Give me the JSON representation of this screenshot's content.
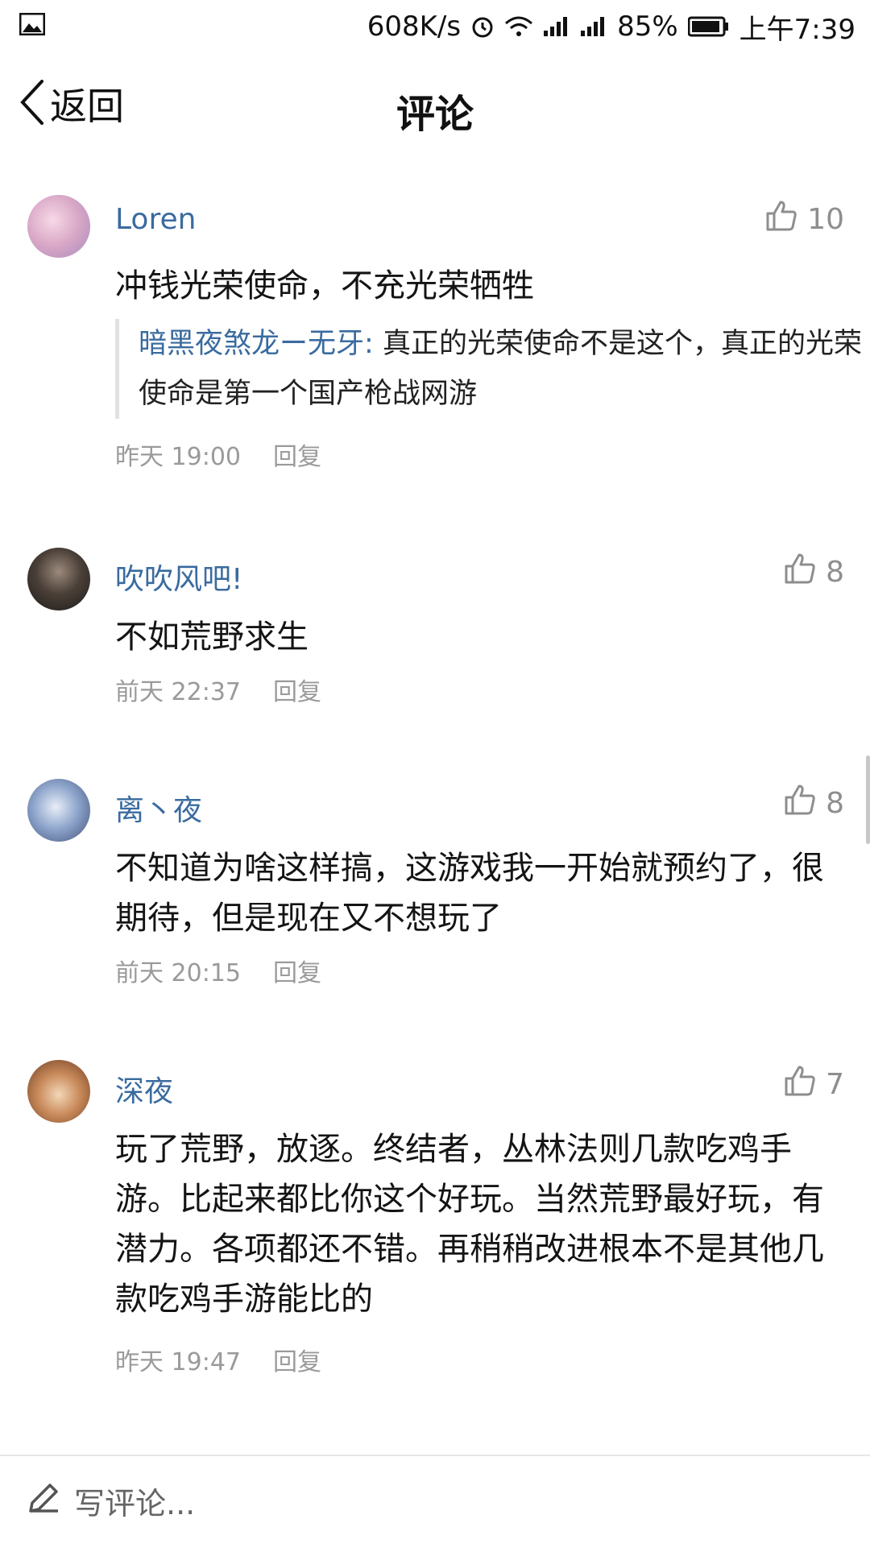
{
  "status_bar": {
    "network_speed": "608K/s",
    "battery": "85%",
    "time": "上午7:39",
    "icons": [
      "image-icon",
      "alarm-icon",
      "wifi-icon",
      "signal-icon",
      "signal-icon",
      "battery-icon"
    ]
  },
  "header": {
    "back_label": "返回",
    "title": "评论"
  },
  "comments": [
    {
      "user": "Loren",
      "likes": "10",
      "text": "冲钱光荣使命，不充光荣牺牲",
      "quote": {
        "user": "暗黑夜煞龙ー无牙:",
        "text": "真正的光荣使命不是这个，真正的光荣使命是第一个国产枪战网游"
      },
      "time": "昨天 19:00",
      "reply": "回复"
    },
    {
      "user": "吹吹风吧!",
      "likes": "8",
      "text": "不如荒野求生",
      "time": "前天 22:37",
      "reply": "回复"
    },
    {
      "user": "离丶夜",
      "likes": "8",
      "text": "不知道为啥这样搞，这游戏我一开始就预约了，很期待，但是现在又不想玩了",
      "time": "前天 20:15",
      "reply": "回复"
    },
    {
      "user": "深夜",
      "likes": "7",
      "text": "玩了荒野，放逐。终结者，丛林法则几款吃鸡手游。比起来都比你这个好玩。当然荒野最好玩，有潜力。各项都还不错。再稍稍改进根本不是其他几款吃鸡手游能比的",
      "time": "昨天 19:47",
      "reply": "回复"
    }
  ],
  "bottom_bar": {
    "placeholder": "写评论..."
  },
  "colors": {
    "link_blue": "#3a6b9f",
    "meta_gray": "#9a9a9a"
  }
}
